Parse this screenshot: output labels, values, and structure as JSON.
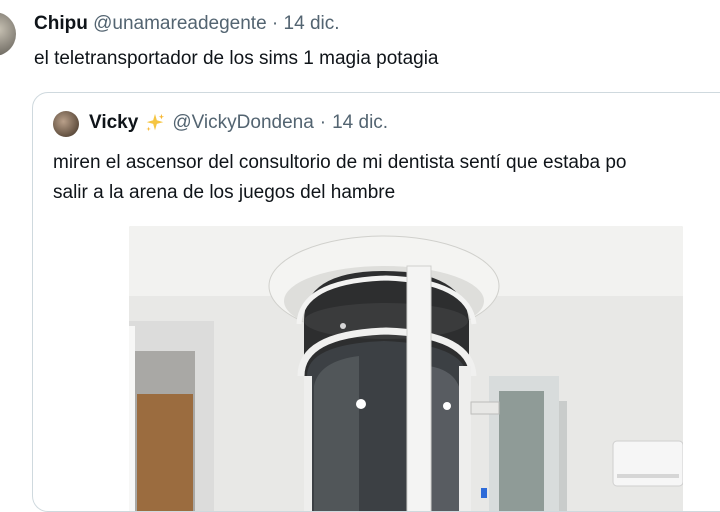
{
  "tweet": {
    "name": "Chipu",
    "handle": "@unamareadegente",
    "dot": "·",
    "date": "14 dic.",
    "text": "el teletransportador de los sims 1 magia potagia"
  },
  "quote": {
    "name": "Vicky",
    "handle": "@VickyDondena",
    "dot": "·",
    "date": "14 dic.",
    "line1": "miren el ascensor del consultorio de mi dentista sentí que estaba po",
    "line2": "salir a la arena de los juegos del hambre",
    "media_icon": "photo-elevator"
  },
  "colors": {
    "text": "#0f1419",
    "secondary": "#536471",
    "border": "#cfd9de",
    "sparkle": "#f5c542"
  }
}
